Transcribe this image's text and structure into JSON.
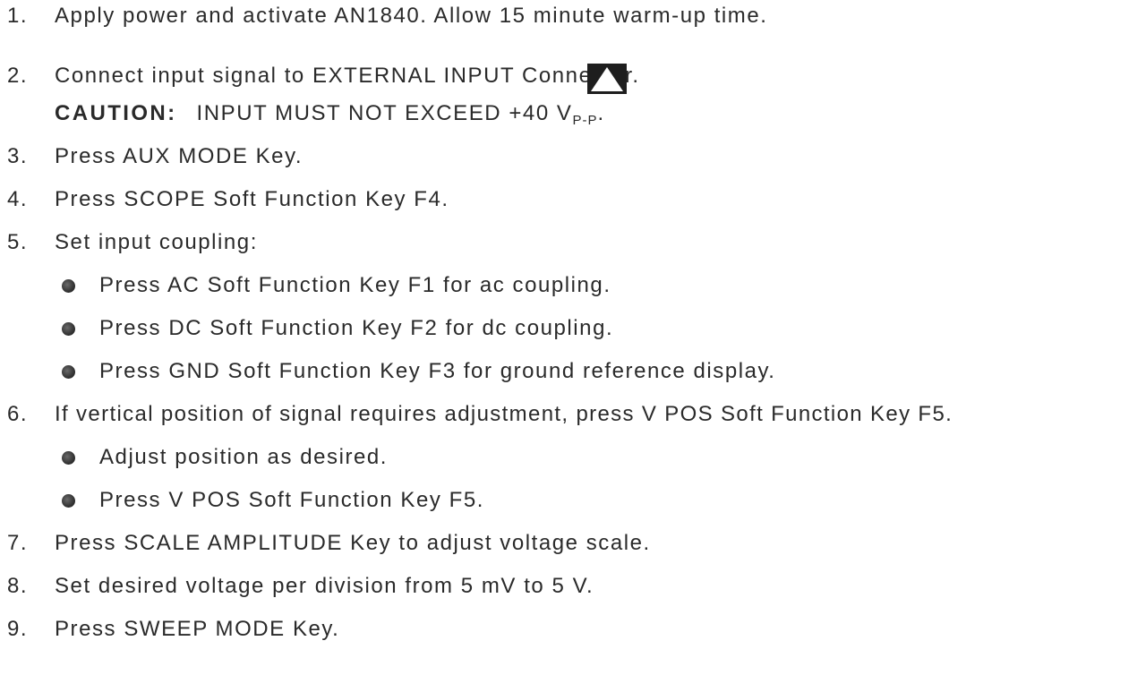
{
  "steps": [
    {
      "num": "1.",
      "text": "Apply power and activate AN1840.  Allow 15 minute warm-up time."
    },
    {
      "num": "2.",
      "text": "Connect input signal to EXTERNAL INPUT Connector."
    },
    {
      "num": "3.",
      "text": "Press AUX MODE Key."
    },
    {
      "num": "4.",
      "text": "Press SCOPE Soft Function Key F4."
    },
    {
      "num": "5.",
      "text": "Set input coupling:"
    },
    {
      "num": "6.",
      "text": "If vertical position of signal requires adjustment, press V POS Soft Function Key F5."
    },
    {
      "num": "7.",
      "text": "Press SCALE AMPLITUDE Key to adjust voltage scale."
    },
    {
      "num": "8.",
      "text": "Set desired voltage per division from 5 mV to 5 V."
    },
    {
      "num": "9.",
      "text": "Press SWEEP MODE Key."
    }
  ],
  "caution": {
    "label": "CAUTION:",
    "text": "INPUT MUST NOT EXCEED +40 V",
    "subscript": "P-P",
    "suffix": "."
  },
  "step5_bullets": [
    "Press AC Soft Function Key F1 for ac coupling.",
    "Press DC Soft Function Key F2 for dc coupling.",
    "Press GND Soft Function Key F3 for ground reference display."
  ],
  "step6_bullets": [
    "Adjust position as desired.",
    "Press V POS Soft Function Key F5."
  ],
  "warning_icon": "caution-triangle-icon"
}
